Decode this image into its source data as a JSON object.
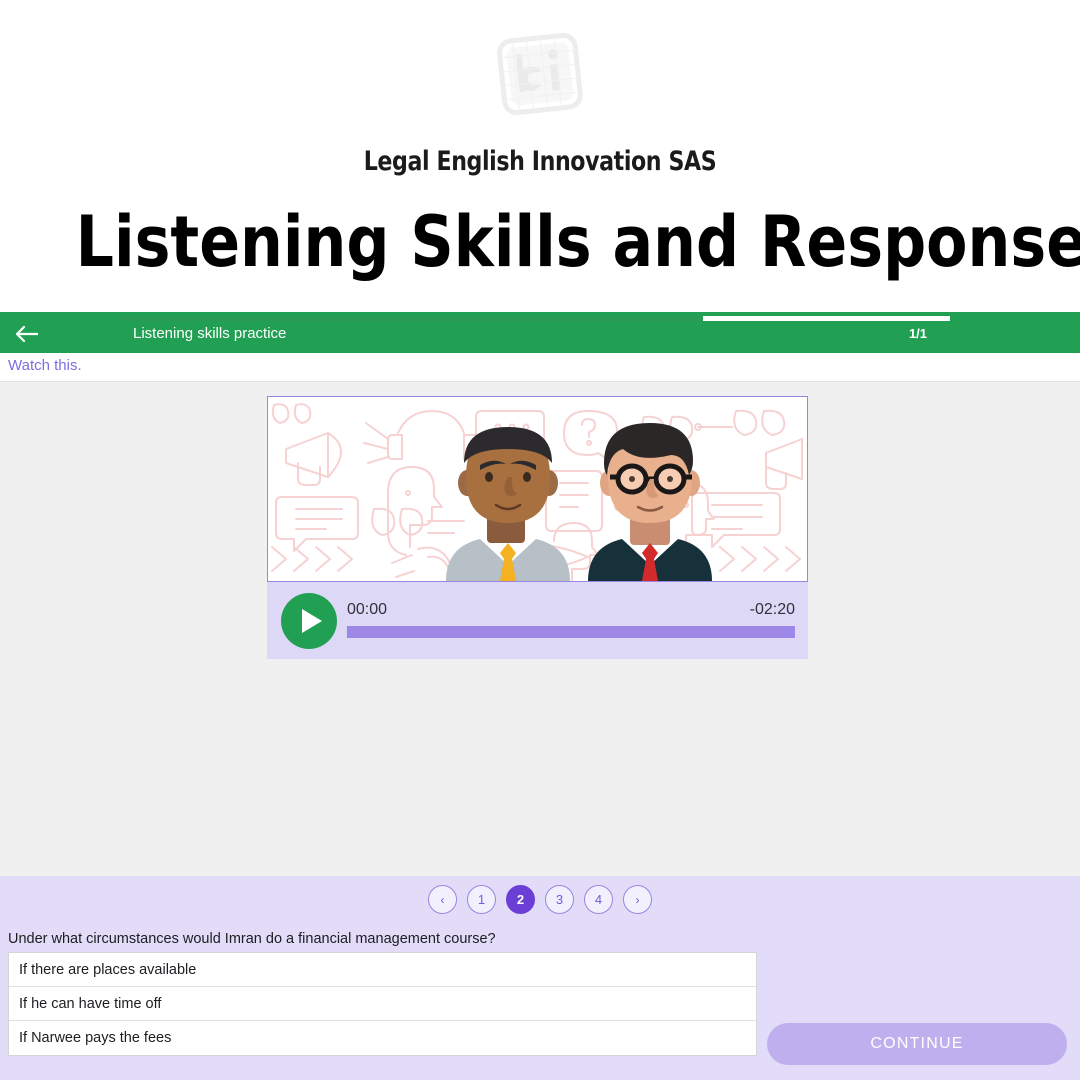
{
  "brand": {
    "logo_icon": "lei-logo-icon",
    "name": "Legal English Innovation SAS"
  },
  "page_title": "Listening Skills and Response",
  "topbar": {
    "back_icon": "back-arrow-icon",
    "title": "Listening skills practice",
    "counter": "1/1",
    "progress_percent": 30,
    "accent_color": "#21a053"
  },
  "instruction": {
    "text": "Watch this.",
    "color": "#7b6fe0"
  },
  "media": {
    "thumbnail_alt": "two-business-men-illustration",
    "player": {
      "play_icon": "play-icon",
      "current_time": "00:00",
      "remaining_time": "-02:20",
      "progress_percent": 0
    }
  },
  "question_panel": {
    "pager": [
      {
        "label": "‹",
        "name": "pager-prev",
        "active": false
      },
      {
        "label": "1",
        "name": "pager-page-1",
        "active": false
      },
      {
        "label": "2",
        "name": "pager-page-2",
        "active": true
      },
      {
        "label": "3",
        "name": "pager-page-3",
        "active": false
      },
      {
        "label": "4",
        "name": "pager-page-4",
        "active": false
      },
      {
        "label": "›",
        "name": "pager-next",
        "active": false
      }
    ],
    "question": "Under what circumstances would Imran do a financial management course?",
    "answers": [
      "If there are places available",
      "If he can have time off",
      "If Narwee pays the fees"
    ],
    "continue_label": "CONTINUE",
    "continue_enabled": false
  }
}
